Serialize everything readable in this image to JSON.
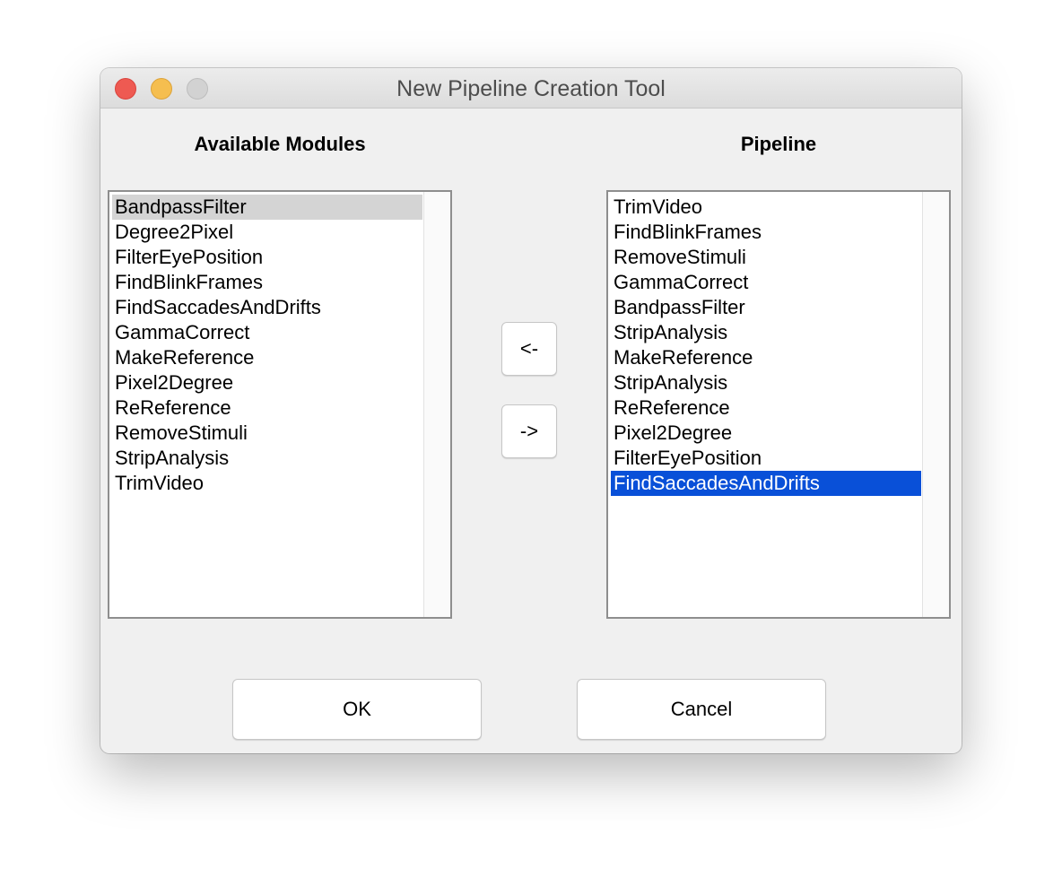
{
  "window": {
    "title": "New Pipeline Creation Tool"
  },
  "available": {
    "heading": "Available Modules",
    "items": [
      "BandpassFilter",
      "Degree2Pixel",
      "FilterEyePosition",
      "FindBlinkFrames",
      "FindSaccadesAndDrifts",
      "GammaCorrect",
      "MakeReference",
      "Pixel2Degree",
      "ReReference",
      "RemoveStimuli",
      "StripAnalysis",
      "TrimVideo"
    ],
    "selected": "BandpassFilter"
  },
  "pipeline": {
    "heading": "Pipeline",
    "items": [
      "TrimVideo",
      "FindBlinkFrames",
      "RemoveStimuli",
      "GammaCorrect",
      "BandpassFilter",
      "StripAnalysis",
      "MakeReference",
      "StripAnalysis",
      "ReReference",
      "Pixel2Degree",
      "FilterEyePosition",
      "FindSaccadesAndDrifts"
    ],
    "selected": "FindSaccadesAndDrifts"
  },
  "buttons": {
    "remove_label": "<-",
    "add_label": "->",
    "ok_label": "OK",
    "cancel_label": "Cancel"
  },
  "colors": {
    "selection_active": "#0950d8",
    "selection_inactive": "#d4d4d4",
    "close": "#ee5a52",
    "minimize": "#f5be4f",
    "zoom_disabled": "#d2d2d2"
  },
  "icons": {
    "close": "close-icon",
    "minimize": "minimize-icon",
    "zoom": "zoom-icon"
  }
}
